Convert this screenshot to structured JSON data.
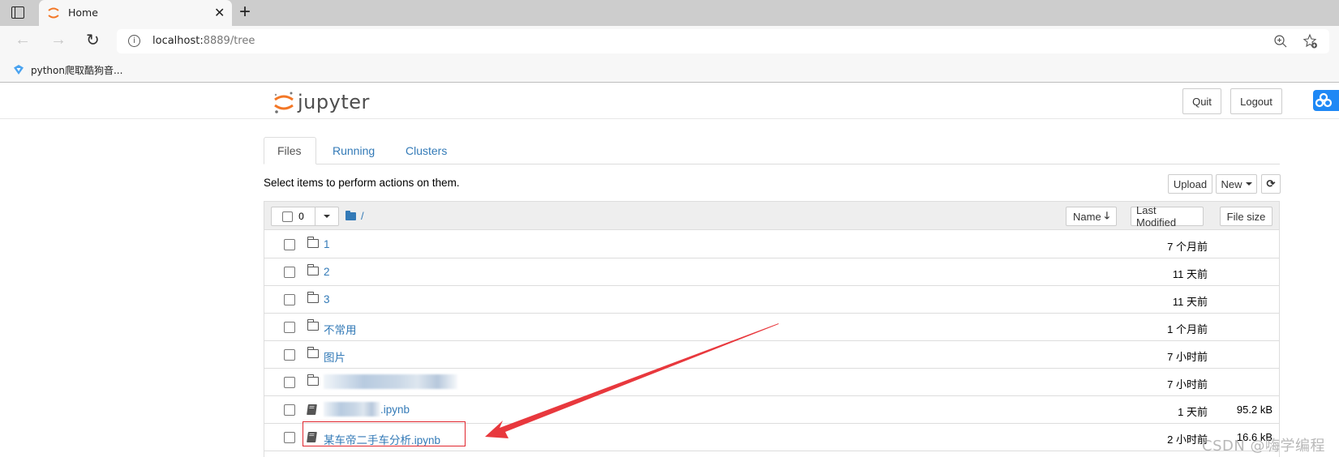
{
  "browser": {
    "tab_title": "Home",
    "url_host": "localhost:",
    "url_path": "8889/tree",
    "bookmark": "python爬取酷狗音..."
  },
  "header": {
    "logo_text": "jupyter",
    "quit_label": "Quit",
    "logout_label": "Logout"
  },
  "tabs": [
    {
      "label": "Files",
      "active": true
    },
    {
      "label": "Running",
      "active": false
    },
    {
      "label": "Clusters",
      "active": false
    }
  ],
  "toolbar": {
    "hint": "Select items to perform actions on them.",
    "upload_label": "Upload",
    "new_label": "New",
    "refresh_icon": "refresh-icon"
  },
  "list_header": {
    "selected_count": "0",
    "breadcrumb": "/",
    "sort_name": "Name",
    "sort_modified": "Last Modified",
    "sort_size": "File size"
  },
  "files": [
    {
      "type": "folder",
      "name": "1",
      "modified": "7 个月前",
      "size": ""
    },
    {
      "type": "folder",
      "name": "2",
      "modified": "11 天前",
      "size": ""
    },
    {
      "type": "folder",
      "name": "3",
      "modified": "11 天前",
      "size": ""
    },
    {
      "type": "folder",
      "name": "不常用",
      "modified": "1 个月前",
      "size": ""
    },
    {
      "type": "folder",
      "name": "图片",
      "modified": "7 小时前",
      "size": ""
    },
    {
      "type": "folder",
      "name": "",
      "modified": "7 小时前",
      "size": "",
      "blurred": true
    },
    {
      "type": "notebook",
      "name": ".ipynb",
      "modified": "1 天前",
      "size": "95.2 kB",
      "blurred": true
    },
    {
      "type": "notebook",
      "name": "某车帝二手车分析.ipynb",
      "modified": "2 小时前",
      "size": "16.6 kB",
      "highlighted": true
    }
  ],
  "annotation": {
    "color": "#e8383d"
  },
  "watermark": "CSDN @嗨学编程",
  "colors": {
    "link": "#337ab7",
    "jupyter_orange": "#f37726",
    "highlight_box": "#e0262e"
  }
}
